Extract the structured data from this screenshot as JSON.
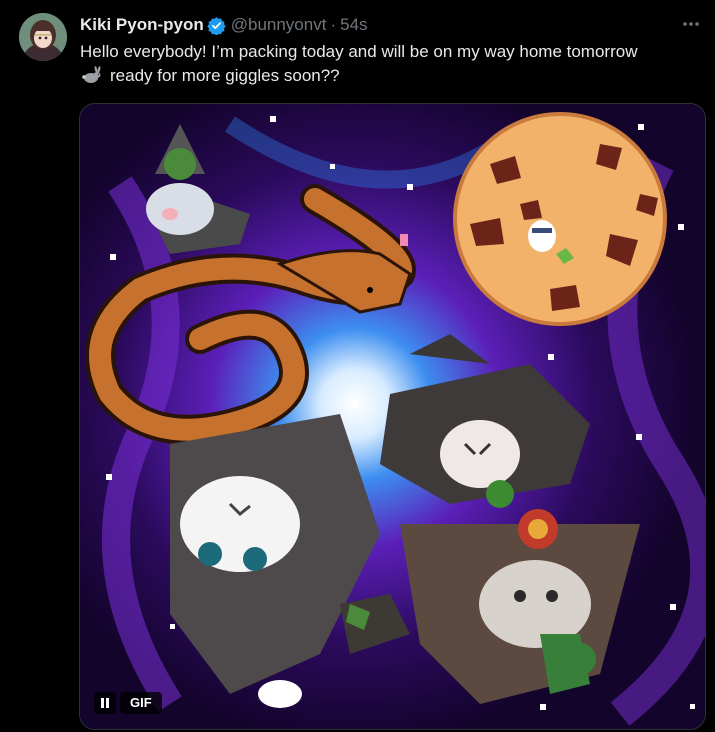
{
  "author": {
    "display_name": "Kiki Pyon-pyon",
    "handle": "@bunnyonvt",
    "separator": "·",
    "timestamp": "54s",
    "verified": true
  },
  "tweet": {
    "line1": "Hello everybody! I’m packing today and will be on my way home tomorrow",
    "line2": "ready for more giggles soon??",
    "emoji": "rabbit-icon"
  },
  "media": {
    "type": "gif",
    "badge_label": "GIF",
    "playback": "playing"
  },
  "colors": {
    "background": "#000000",
    "text_primary": "#e7e9ea",
    "text_secondary": "#71767b",
    "verified": "#1d9bf0",
    "media_border": "#2f3336"
  }
}
